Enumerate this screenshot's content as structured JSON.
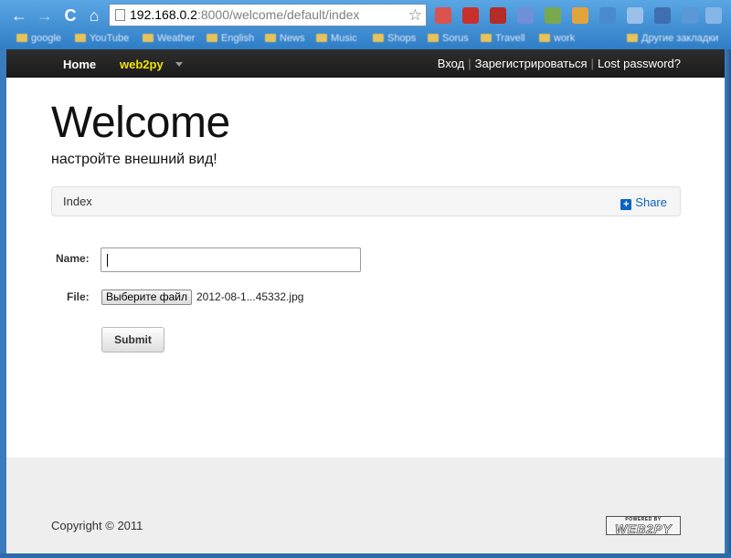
{
  "browser": {
    "url_host": "192.168.0.2",
    "url_rest": ":8000/welcome/default/index",
    "nav": {
      "back": "←",
      "forward": "→",
      "reload": "C",
      "home": "⌂"
    },
    "star": "☆",
    "bookmarks": [
      "google",
      "YouTube",
      "Weather",
      "English",
      "News",
      "Music",
      "Shops",
      "Sorus",
      "Travell",
      "work",
      "Другие закладки"
    ]
  },
  "navbar": {
    "home": "Home",
    "brand": "web2py",
    "login": "Вход",
    "register": "Зарегистрироваться",
    "lost_password": "Lost password?",
    "separator": "|"
  },
  "main": {
    "title": "Welcome",
    "subtitle": "настройте внешний вид!",
    "breadcrumb": "Index",
    "share": "Share",
    "share_icon": "plus-icon"
  },
  "form": {
    "name_label": "Name:",
    "name_value": "",
    "file_label": "File:",
    "file_button": "Выберите файл",
    "file_name": "2012-08-1...45332.jpg",
    "submit": "Submit"
  },
  "footer": {
    "copyright": "Copyright © 2011",
    "powered_by": "POWERED BY",
    "powered_logo": "WEB2PY"
  },
  "colors": {
    "navbar_bg": "#222222",
    "brand": "#f1e400",
    "share": "#0a63c0",
    "footer_bg": "#eeeeee"
  }
}
